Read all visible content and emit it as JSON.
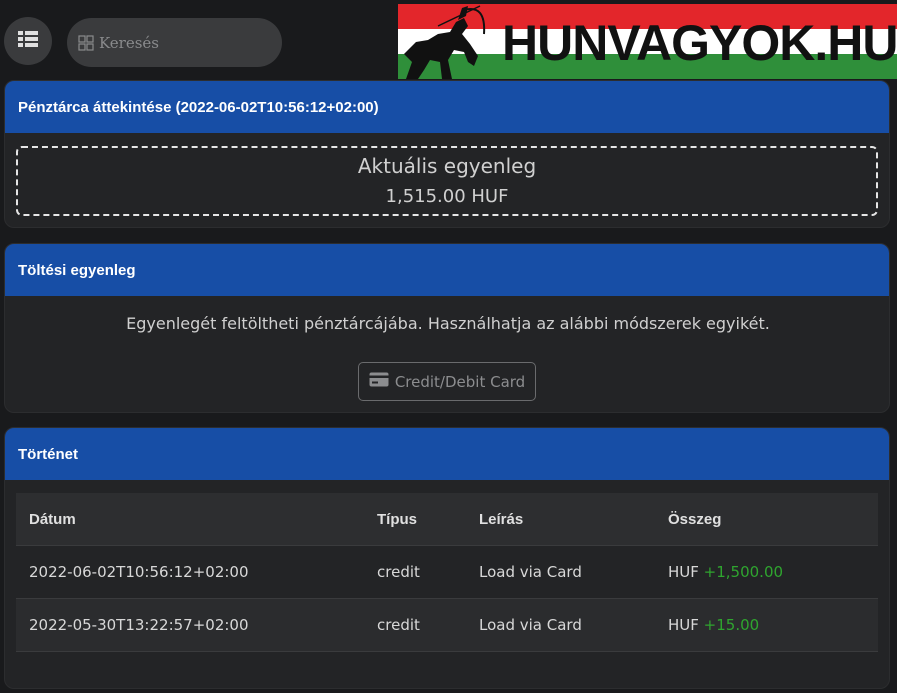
{
  "search": {
    "placeholder": "Keresés"
  },
  "logo": {
    "text": "HUNVAGYOK.HU"
  },
  "overview": {
    "title": "Pénztárca áttekintése (2022-06-02T10:56:12+02:00)",
    "balance_label": "Aktuális egyenleg",
    "balance_value": "1,515.00 HUF"
  },
  "topup": {
    "title": "Töltési egyenleg",
    "text": "Egyenlegét feltöltheti pénztárcájába. Használhatja az alábbi módszerek egyikét.",
    "button_label": "Credit/Debit Card"
  },
  "history": {
    "title": "Történet",
    "columns": [
      "Dátum",
      "Típus",
      "Leírás",
      "Összeg"
    ],
    "rows": [
      {
        "date": "2022-06-02T10:56:12+02:00",
        "type": "credit",
        "description": "Load via Card",
        "currency": "HUF",
        "amount": "+1,500.00"
      },
      {
        "date": "2022-05-30T13:22:57+02:00",
        "type": "credit",
        "description": "Load via Card",
        "currency": "HUF",
        "amount": "+15.00"
      }
    ]
  },
  "colors": {
    "header_blue": "#174ea6",
    "positive_green": "#2fa52f",
    "background": "#191a1c"
  }
}
